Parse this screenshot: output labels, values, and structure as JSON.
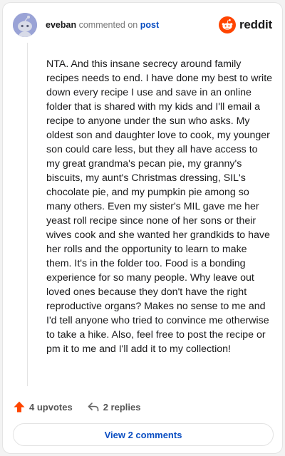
{
  "header": {
    "username": "eveban",
    "commented_on": "commented on",
    "post_link": "post",
    "brand": "reddit",
    "brand_color": "#ff4500"
  },
  "comment": {
    "text": "NTA. And this insane secrecy around family recipes needs to end. I have done my best to write down every recipe I use and save in an online folder that is shared with my kids and I'll email a recipe to anyone under the sun who asks. My oldest son and daughter love to cook, my younger son could care less, but they all have access to my great grandma's pecan pie, my granny's biscuits, my aunt's Christmas dressing, SIL's chocolate pie, and my pumpkin pie among so many others. Even my sister's MIL gave me her yeast roll recipe since none of her sons or their wives cook and she wanted her grandkids to have her rolls and the opportunity to learn to make them. It's in the folder too. Food is a bonding experience for so many people. Why leave out loved ones because they don't have the right reproductive organs? Makes no sense to me and I'd tell anyone who tried to convince me otherwise to take a hike. Also, feel free to post the recipe or pm it to me and I'll add it to my collection!"
  },
  "actions": {
    "upvotes": "4 upvotes",
    "replies": "2 replies",
    "upvote_icon": "upvote-arrow-icon",
    "reply_icon": "reply-arrow-icon",
    "upvote_color": "#ff4500"
  },
  "footer": {
    "view_comments": "View 2 comments"
  }
}
